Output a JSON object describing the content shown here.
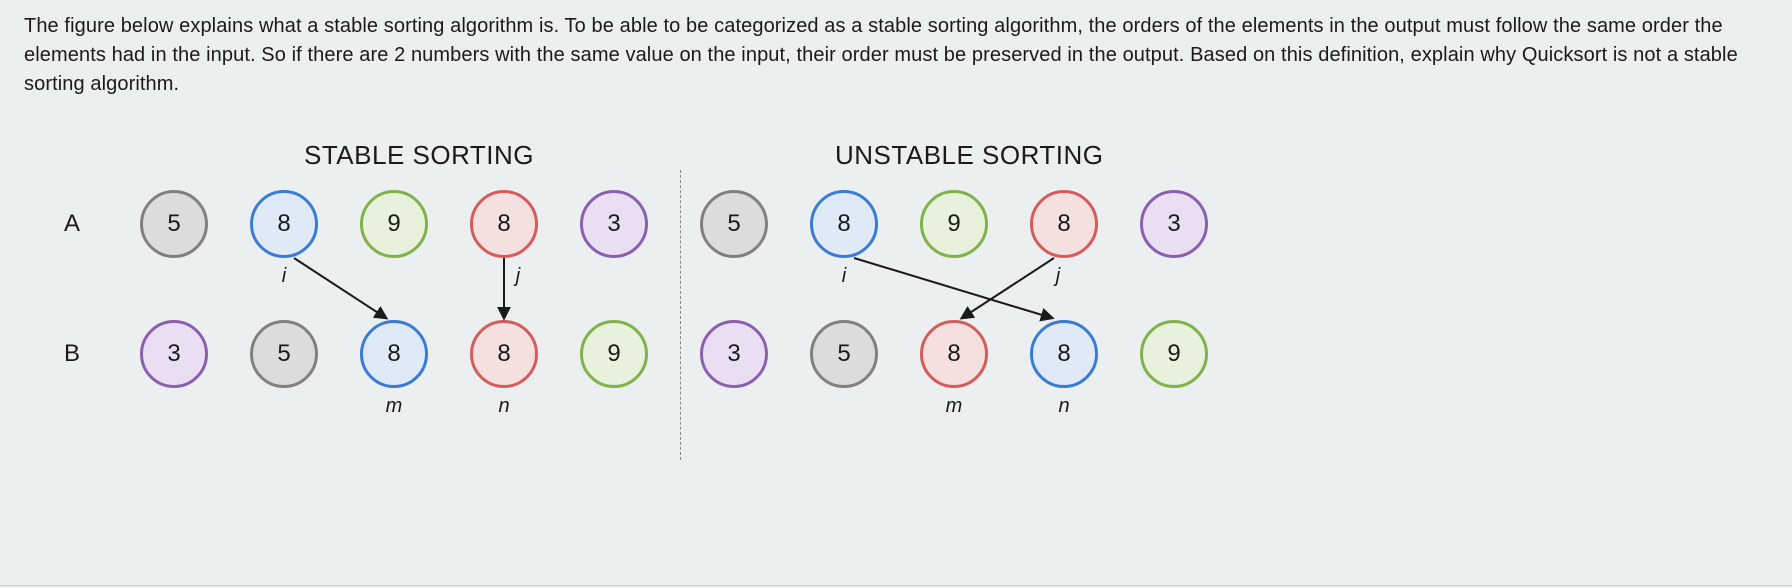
{
  "prompt_text": "The figure below explains what a stable sorting algorithm is. To be able to be categorized as a stable sorting algorithm, the orders of the elements in the output must follow the same order the elements had in the input.  So if there are 2 numbers with the same value on the input, their order must be preserved in the output.  Based on this definition, explain why Quicksort is not a stable sorting algorithm.",
  "headings": {
    "stable": "STABLE SORTING",
    "unstable": "UNSTABLE SORTING"
  },
  "row_labels": {
    "A": "A",
    "B": "B"
  },
  "sub_labels": {
    "i": "i",
    "j": "j",
    "m": "m",
    "n": "n"
  },
  "stable": {
    "A": [
      {
        "value": "5",
        "color": "gray"
      },
      {
        "value": "8",
        "color": "blue"
      },
      {
        "value": "9",
        "color": "green"
      },
      {
        "value": "8",
        "color": "red"
      },
      {
        "value": "3",
        "color": "purple"
      }
    ],
    "B": [
      {
        "value": "3",
        "color": "purple"
      },
      {
        "value": "5",
        "color": "gray"
      },
      {
        "value": "8",
        "color": "blue"
      },
      {
        "value": "8",
        "color": "red"
      },
      {
        "value": "9",
        "color": "green"
      }
    ]
  },
  "unstable": {
    "A": [
      {
        "value": "5",
        "color": "gray"
      },
      {
        "value": "8",
        "color": "blue"
      },
      {
        "value": "9",
        "color": "green"
      },
      {
        "value": "8",
        "color": "red"
      },
      {
        "value": "3",
        "color": "purple"
      }
    ],
    "B": [
      {
        "value": "3",
        "color": "purple"
      },
      {
        "value": "5",
        "color": "gray"
      },
      {
        "value": "8",
        "color": "red"
      },
      {
        "value": "8",
        "color": "blue"
      },
      {
        "value": "9",
        "color": "green"
      }
    ]
  }
}
